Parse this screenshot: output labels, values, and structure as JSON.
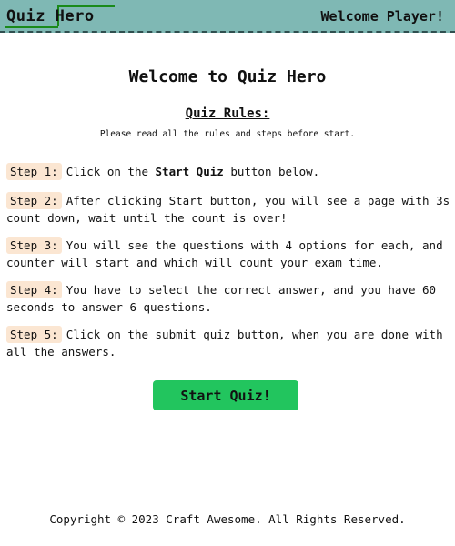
{
  "header": {
    "logo_text": "Quiz Hero",
    "welcome": "Welcome Player!"
  },
  "main": {
    "title": "Welcome to Quiz Hero",
    "rules_title": "Quiz Rules:",
    "rules_subtitle": "Please read all the rules and steps before start.",
    "steps": [
      {
        "label": "Step 1:",
        "pre": "Click on the ",
        "strong": "Start Quiz",
        "post": " button below."
      },
      {
        "label": "Step 2:",
        "text": "After clicking Start button, you will see a page with 3s count down, wait until the count is over!"
      },
      {
        "label": "Step 3:",
        "text": "You will see the questions with 4 options for each, and counter will start and which will count your exam time."
      },
      {
        "label": "Step 4:",
        "text": "You have to select the correct answer, and you have 60 seconds to answer 6 questions."
      },
      {
        "label": "Step 5:",
        "text": "Click on the submit quiz button, when you are done with all the answers."
      }
    ],
    "start_button": "Start Quiz!"
  },
  "footer": {
    "copyright": "Copyright © 2023 Craft Awesome. All Rights Reserved."
  },
  "colors": {
    "header_bg": "#7fb8b4",
    "logo_accent": "#1a8a1a",
    "step_badge_bg": "#fbe6d2",
    "button_bg": "#22c55e"
  }
}
